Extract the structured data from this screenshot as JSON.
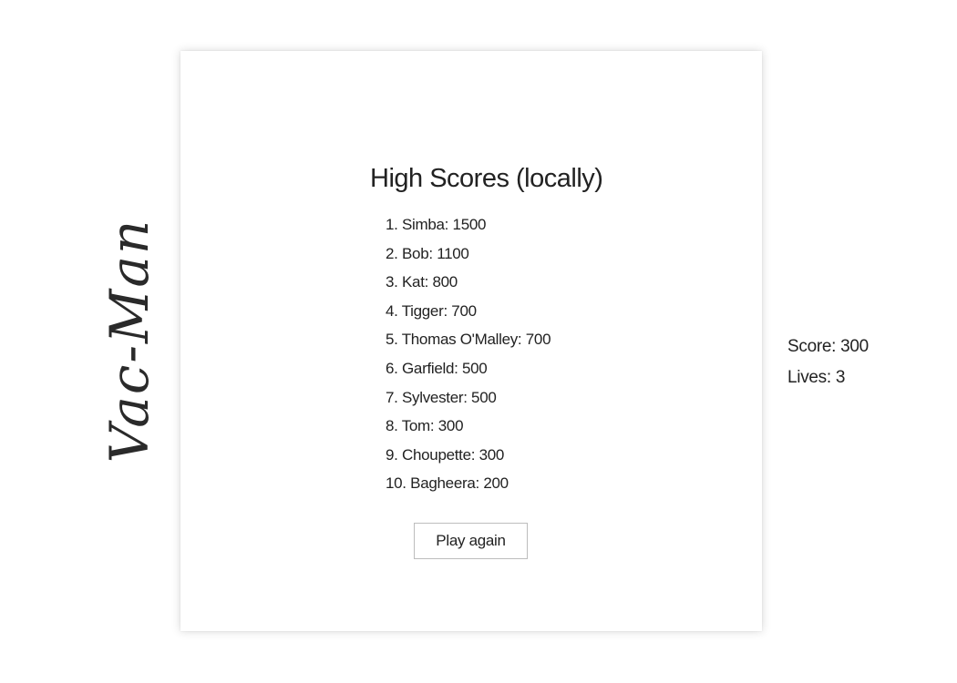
{
  "logo": {
    "text": "Vac-Man"
  },
  "high_scores": {
    "title": "High Scores (locally)",
    "entries": [
      "1. Simba: 1500",
      "2. Bob: 1100",
      "3. Kat: 800",
      "4. Tigger: 700",
      "5. Thomas O'Malley: 700",
      "6. Garfield: 500",
      "7. Sylvester: 500",
      "8. Tom: 300",
      "9. Choupette: 300",
      "10. Bagheera: 200"
    ],
    "play_again_label": "Play again"
  },
  "stats": {
    "score_label": "Score: 300",
    "lives_label": "Lives: 3"
  }
}
